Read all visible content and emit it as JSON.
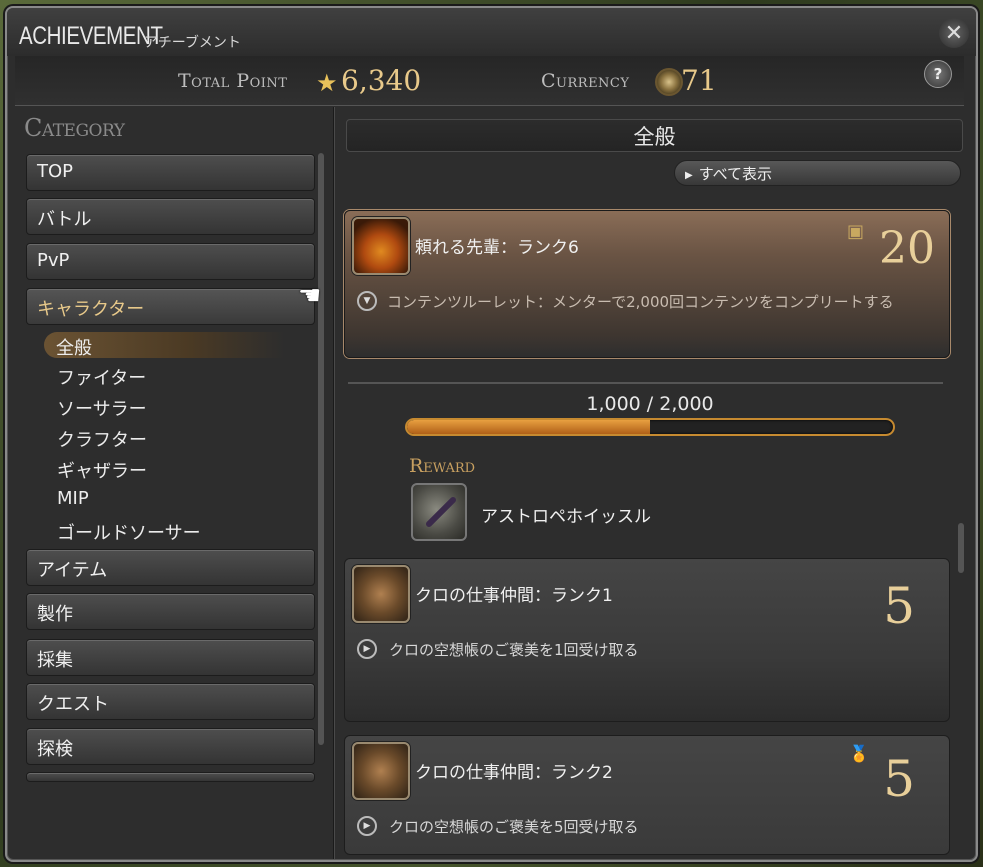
{
  "window": {
    "title": "ACHIEVEMENT",
    "subtitle": "アチーブメント",
    "close_icon": "close-icon",
    "help_label": "?"
  },
  "summary": {
    "total_point_label": "Total Point",
    "total_point_value": "6,340",
    "currency_label": "Currency",
    "currency_value": "71"
  },
  "sidebar": {
    "category_label": "Category",
    "categories": [
      {
        "label": "TOP"
      },
      {
        "label": "バトル"
      },
      {
        "label": "PvP"
      },
      {
        "label": "キャラクター"
      },
      {
        "label": "アイテム"
      },
      {
        "label": "製作"
      },
      {
        "label": "採集"
      },
      {
        "label": "クエスト"
      },
      {
        "label": "探検"
      }
    ],
    "subcategories": [
      {
        "label": "全般"
      },
      {
        "label": "ファイター"
      },
      {
        "label": "ソーサラー"
      },
      {
        "label": "クラフター"
      },
      {
        "label": "ギャザラー"
      },
      {
        "label": "MIP"
      },
      {
        "label": "ゴールドソーサー"
      }
    ]
  },
  "main": {
    "header": "全般",
    "show_all_label": "すべて表示",
    "achievements": [
      {
        "title": "頼れる先輩：ランク6",
        "points": "20",
        "description": "コンテンツルーレット：メンターで2,000回コンテンツをコンプリートする",
        "progress_text": "1,000 / 2,000",
        "progress_fraction": 0.5,
        "reward_label": "Reward",
        "reward_name": "アストロペホイッスル"
      },
      {
        "title": "クロの仕事仲間：ランク1",
        "points": "5",
        "description": "クロの空想帳のご褒美を1回受け取る"
      },
      {
        "title": "クロの仕事仲間：ランク2",
        "points": "5",
        "description": "クロの空想帳のご褒美を5回受け取る"
      }
    ]
  },
  "colors": {
    "accent_gold": "#e8c98a",
    "progress_orange": "#c68a30"
  }
}
